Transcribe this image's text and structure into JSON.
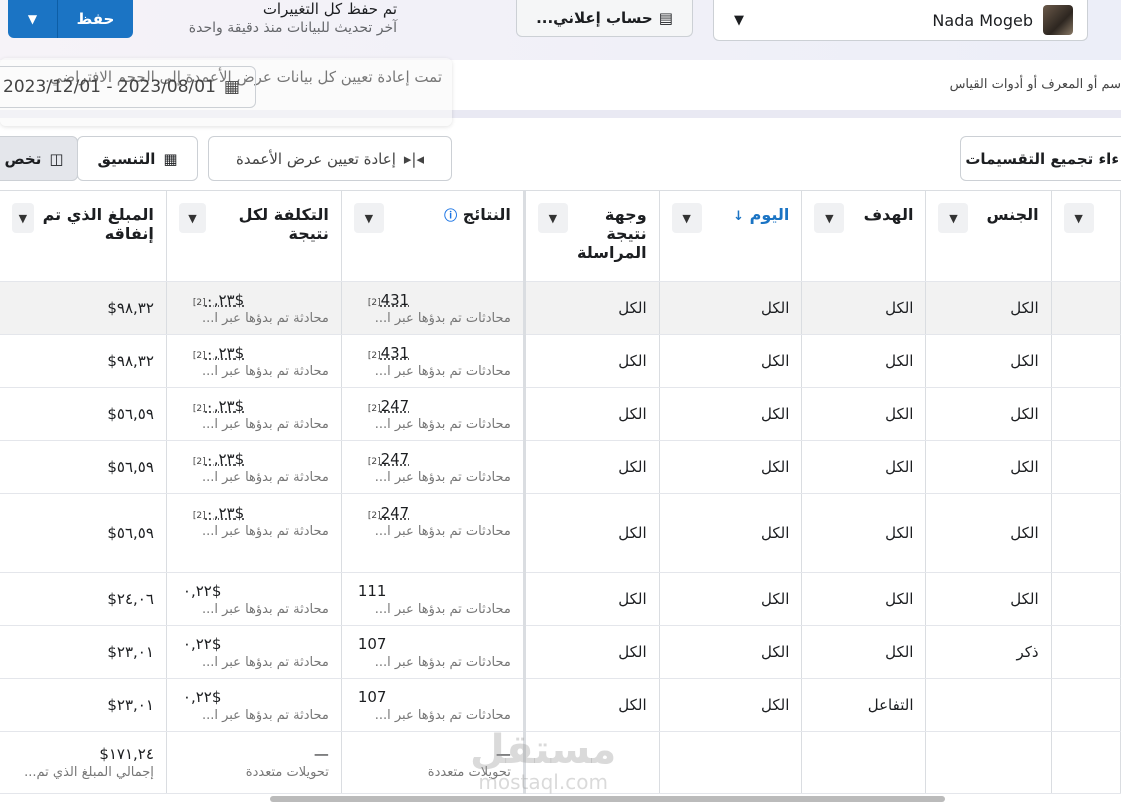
{
  "topbar": {
    "save_label": "حفظ",
    "saved_title": "تم حفظ كل التغييرات",
    "saved_sub": "آخر تحديث للبيانات منذ دقيقة واحدة",
    "account_label": "حساب إعلاني...",
    "user_name": "Nada Mogeb"
  },
  "search": {
    "placeholder": "سم أو المعرف أو أدوات القياس"
  },
  "date_range": "2023/12/01 - 2023/08/01",
  "toast": "تمت إعادة تعيين كل بيانات عرض الأعمدة إلى الحجم الافتراضي.",
  "toolbar": {
    "customize": "تخص",
    "format": "التنسيق",
    "reset_width": "إعادة تعيين عرض الأعمدة",
    "ungroup": "ءاء تجميع التقسيمات"
  },
  "columns": [
    "المبلغ الذي تم إنفاقه",
    "التكلفة لكل نتيجة",
    "النتائج",
    "وجهة نتيجة المراسلة",
    "اليوم",
    "الهدف",
    "الجنس"
  ],
  "cell_sub_results": "محادثات تم بدؤها عبر ا...",
  "cell_sub_cost": "محادثة تم بدؤها عبر ا...",
  "rows": [
    {
      "amount": "٩٨,٣٢$",
      "cost": "٠,٢٣$",
      "results": "431",
      "fn": "[2]",
      "dest": "الكل",
      "day": "الكل",
      "goal": "الكل",
      "gender": "الكل"
    },
    {
      "amount": "٩٨,٣٢$",
      "cost": "٠,٢٣$",
      "results": "431",
      "fn": "[2]",
      "dest": "الكل",
      "day": "الكل",
      "goal": "الكل",
      "gender": "الكل"
    },
    {
      "amount": "٥٦,٥٩$",
      "cost": "٠,٢٣$",
      "results": "247",
      "fn": "[2]",
      "dest": "الكل",
      "day": "الكل",
      "goal": "الكل",
      "gender": "الكل"
    },
    {
      "amount": "٥٦,٥٩$",
      "cost": "٠,٢٣$",
      "results": "247",
      "fn": "[2]",
      "dest": "الكل",
      "day": "الكل",
      "goal": "الكل",
      "gender": "الكل"
    },
    {
      "amount": "٥٦,٥٩$",
      "cost": "٠,٢٣$",
      "results": "247",
      "fn": "[2]",
      "dest": "الكل",
      "day": "الكل",
      "goal": "الكل",
      "gender": "الكل"
    },
    {
      "amount": "٢٤,٠٦$",
      "cost": "٠,٢٢$",
      "results": "111",
      "fn": "",
      "dest": "الكل",
      "day": "الكل",
      "goal": "الكل",
      "gender": "الكل"
    },
    {
      "amount": "٢٣,٠١$",
      "cost": "٠,٢٢$",
      "results": "107",
      "fn": "",
      "dest": "الكل",
      "day": "الكل",
      "goal": "الكل",
      "gender": "ذكر"
    },
    {
      "amount": "٢٣,٠١$",
      "cost": "٠,٢٢$",
      "results": "107",
      "fn": "",
      "dest": "الكل",
      "day": "الكل",
      "goal": "التفاعل",
      "gender": ""
    }
  ],
  "footer": {
    "amount": "١٧١,٢٤$",
    "amount_sub": "إجمالي المبلغ الذي تم...",
    "dash": "—",
    "multi": "تحويلات متعددة"
  },
  "watermark": {
    "ar": "مستقل",
    "en": "mostaql.com"
  }
}
